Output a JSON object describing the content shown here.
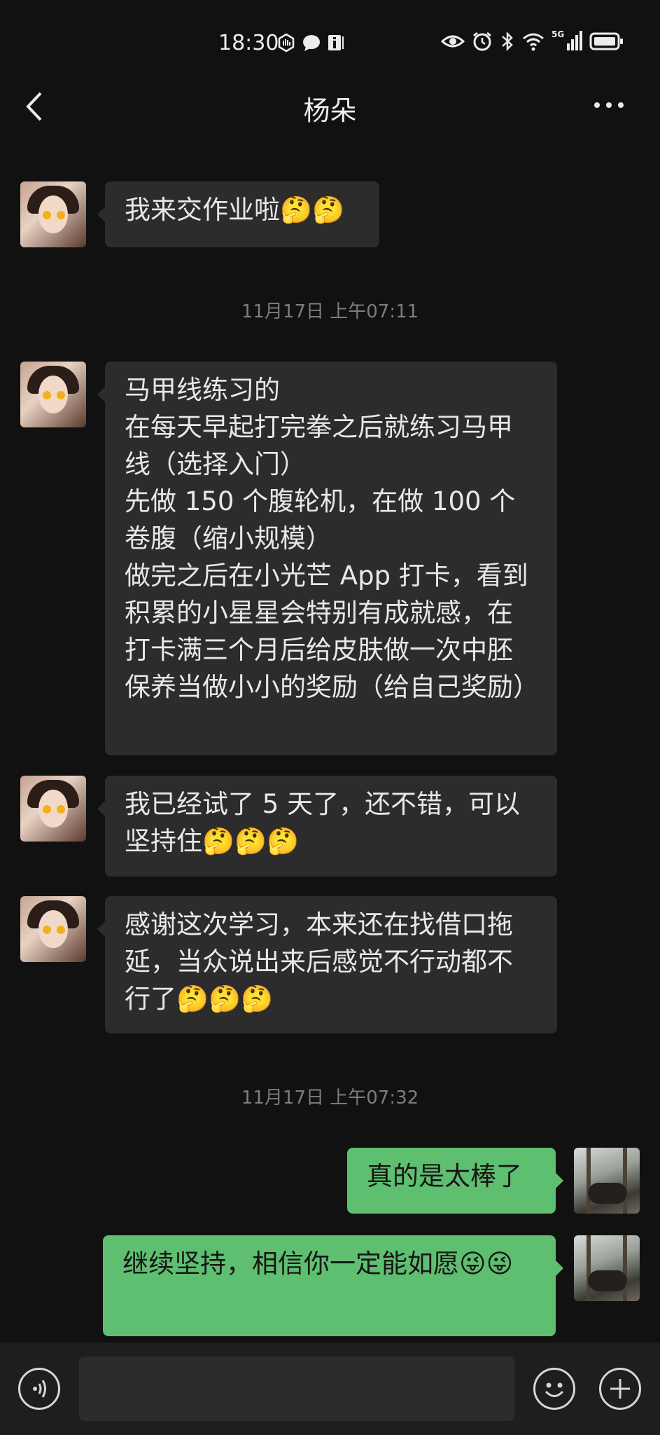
{
  "status_bar": {
    "time": "18:30",
    "network_label": "5G"
  },
  "header": {
    "title": "杨朵"
  },
  "messages": [
    {
      "id": "m1",
      "text": "我来交作业啦🤔🤔"
    },
    {
      "id": "ts1",
      "text": "11月17日 上午07:11"
    },
    {
      "id": "m2",
      "text": "马甲线练习的\n在每天早起打完拳之后就练习马甲线（选择入门）\n先做 150 个腹轮机，在做 100 个卷腹（缩小规模）\n做完之后在小光芒 App 打卡，看到积累的小星星会特别有成就感，在打卡满三个月后给皮肤做一次中胚保养当做小小的奖励（给自己奖励）"
    },
    {
      "id": "m3",
      "text": "我已经试了 5 天了，还不错，可以坚持住🤔🤔🤔"
    },
    {
      "id": "m4",
      "text": "感谢这次学习，本来还在找借口拖延，当众说出来后感觉不行动都不行了🤔🤔🤔"
    },
    {
      "id": "ts2",
      "text": "11月17日 上午07:32"
    },
    {
      "id": "m5",
      "text": "真的是太棒了"
    },
    {
      "id": "m6",
      "text": "继续坚持，相信你一定能如愿😜😜"
    }
  ],
  "input": {
    "value": ""
  }
}
